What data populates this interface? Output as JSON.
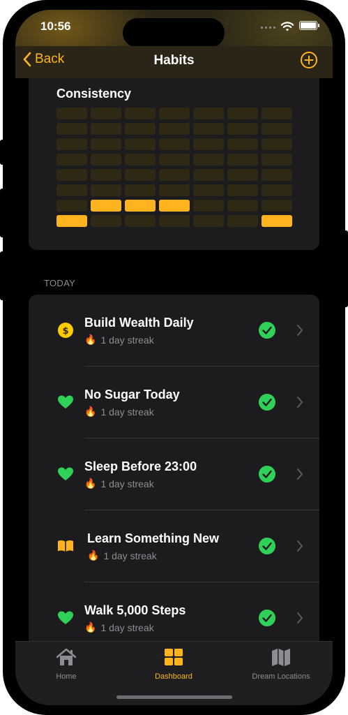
{
  "status_bar": {
    "time": "10:56"
  },
  "nav": {
    "back_label": "Back",
    "title": "Habits"
  },
  "consistency": {
    "title": "Consistency",
    "grid_rows": 8,
    "grid_cols": 7,
    "filled_cells": [
      [
        6,
        1
      ],
      [
        6,
        2
      ],
      [
        6,
        3
      ],
      [
        7,
        0
      ],
      [
        7,
        6
      ]
    ]
  },
  "section_header": "TODAY",
  "habits": [
    {
      "name": "Build Wealth Daily",
      "streak": "1 day streak",
      "icon": "dollar-coin-icon",
      "icon_color": "#ffcc00",
      "completed": true
    },
    {
      "name": "No Sugar Today",
      "streak": "1 day streak",
      "icon": "heart-icon",
      "icon_color": "#30d158",
      "completed": true
    },
    {
      "name": "Sleep Before 23:00",
      "streak": "1 day streak",
      "icon": "heart-icon",
      "icon_color": "#30d158",
      "completed": true
    },
    {
      "name": "Learn Something New",
      "streak": "1 day streak",
      "icon": "book-icon",
      "icon_color": "#ffb41f",
      "completed": true
    },
    {
      "name": "Walk 5,000 Steps",
      "streak": "1 day streak",
      "icon": "heart-icon",
      "icon_color": "#30d158",
      "completed": true
    }
  ],
  "tabs": [
    {
      "label": "Home",
      "icon": "house-icon",
      "active": false
    },
    {
      "label": "Dashboard",
      "icon": "grid-icon",
      "active": true
    },
    {
      "label": "Dream Locations",
      "icon": "map-icon",
      "active": false
    }
  ],
  "colors": {
    "accent": "#ffb41f",
    "success": "#30d158",
    "inactive": "#8d8d93",
    "cell_empty": "#2f2815"
  }
}
